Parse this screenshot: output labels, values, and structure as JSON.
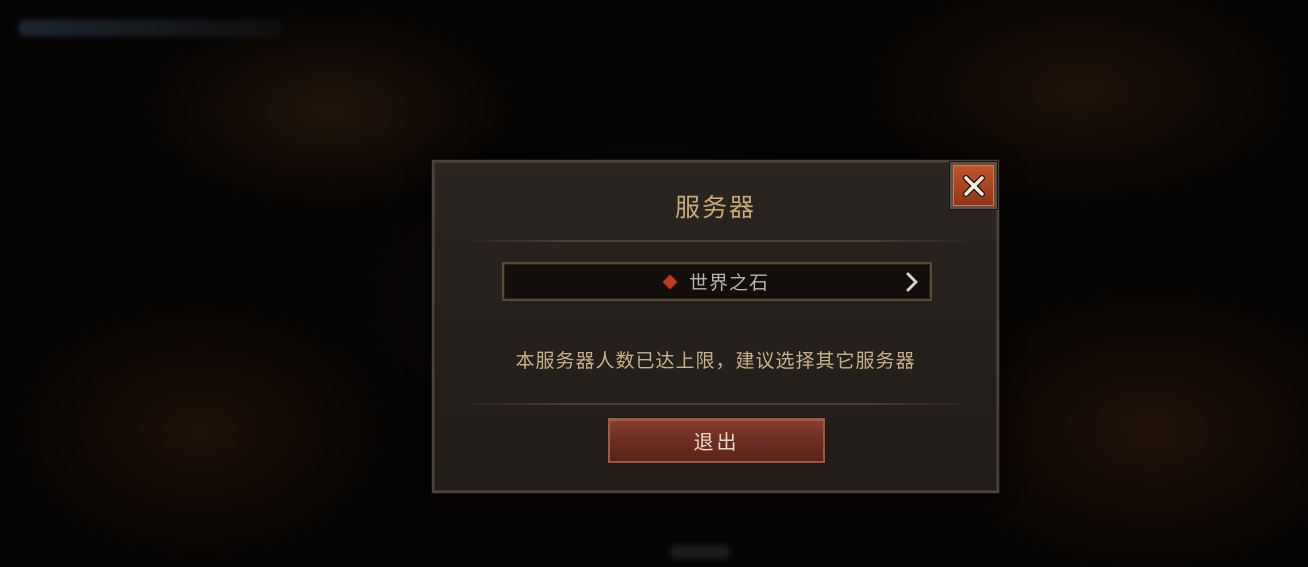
{
  "dialog": {
    "title": "服务器",
    "server": {
      "name": "世界之石",
      "marker_color": "#c0391f"
    },
    "message": "本服务器人数已达上限，建议选择其它服务器",
    "exit_label": "退出"
  },
  "icons": {
    "close": "close-icon",
    "chevron": "chevron-right-icon",
    "marker": "diamond-icon"
  },
  "colors": {
    "accent": "#c9a877",
    "button": "#6e2f22",
    "close": "#b04a24"
  }
}
